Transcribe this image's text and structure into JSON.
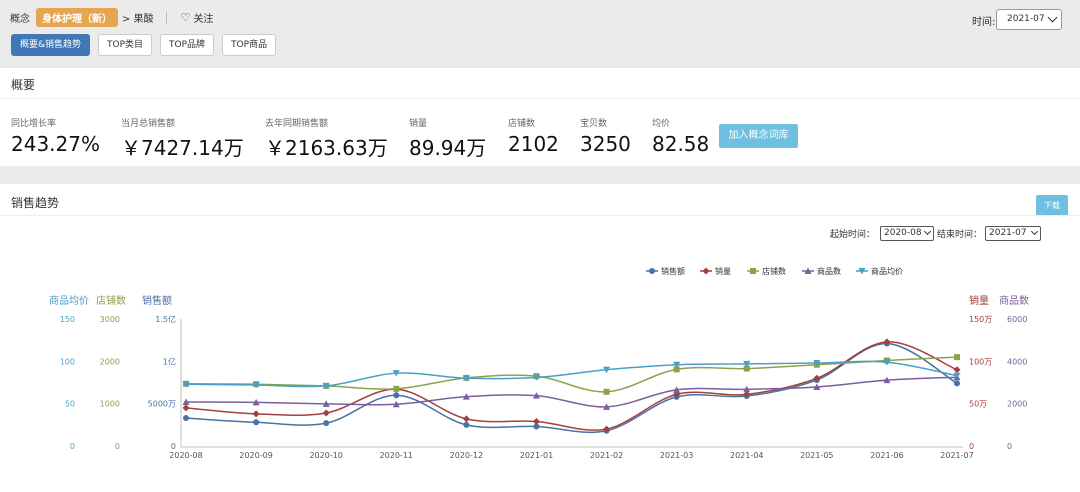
{
  "breadcrumb": {
    "prefix": "概念",
    "tag": "身体护理（新）",
    "tail": "> 果酸",
    "follow_icon": "heart-outline-icon",
    "follow_label": "关注"
  },
  "tabs": [
    {
      "label": "概要&销售趋势",
      "active": true
    },
    {
      "label": "TOP类目",
      "active": false
    },
    {
      "label": "TOP品牌",
      "active": false
    },
    {
      "label": "TOP商品",
      "active": false
    }
  ],
  "time_filter": {
    "label": "时间:",
    "value": "2021-07"
  },
  "overview": {
    "title": "概要",
    "stats": [
      {
        "label": "同比增长率",
        "value": "243.27%"
      },
      {
        "label": "当月总销售额",
        "value": "￥7427.14万"
      },
      {
        "label": "去年同期销售额",
        "value": "￥2163.63万"
      },
      {
        "label": "销量",
        "value": "89.94万"
      },
      {
        "label": "店铺数",
        "value": "2102"
      },
      {
        "label": "宝贝数",
        "value": "3250"
      },
      {
        "label": "均价",
        "value": "82.58"
      }
    ],
    "add_button": "加入概念词库"
  },
  "trend": {
    "title": "销售趋势",
    "download": "下载",
    "start_label": "起始时间：",
    "start_value": "2020-08",
    "end_label": "结束时间：",
    "end_value": "2021-07"
  },
  "chart_data": {
    "type": "line",
    "categories": [
      "2020-08",
      "2020-09",
      "2020-10",
      "2020-11",
      "2020-12",
      "2021-01",
      "2021-02",
      "2021-03",
      "2021-04",
      "2021-05",
      "2021-06",
      "2021-07"
    ],
    "legend_position": "top-right",
    "grid": false,
    "axes": {
      "left": [
        {
          "name": "商品均价",
          "ticks": [
            "0",
            "50",
            "100",
            "150"
          ],
          "range": [
            0,
            150
          ],
          "color": "#4a9fc9"
        },
        {
          "name": "店铺数",
          "ticks": [
            "0",
            "1000",
            "2000",
            "3000"
          ],
          "range": [
            0,
            3000
          ],
          "color": "#8aa34a"
        },
        {
          "name": "销售额",
          "ticks": [
            "0",
            "5000万",
            "1亿",
            "1.5亿"
          ],
          "range": [
            0,
            15000
          ],
          "color": "#4572a7"
        }
      ],
      "right": [
        {
          "name": "销量",
          "ticks": [
            "0",
            "50万",
            "100万",
            "150万"
          ],
          "range": [
            0,
            150
          ],
          "color": "#a3403d"
        },
        {
          "name": "商品数",
          "ticks": [
            "0",
            "2000",
            "4000",
            "6000"
          ],
          "range": [
            0,
            6000
          ],
          "color": "#7a5f9c"
        }
      ]
    },
    "series": [
      {
        "name": "销售额",
        "axis": "left.2",
        "color": "#4572a7",
        "marker": "circle",
        "values": [
          3300,
          2800,
          2700,
          6000,
          2500,
          2300,
          1800,
          5800,
          5900,
          7800,
          12100,
          7400
        ]
      },
      {
        "name": "销量",
        "axis": "right.0",
        "color": "#a3403d",
        "marker": "diamond",
        "values": [
          45,
          38,
          39,
          67,
          32,
          29,
          20,
          61,
          61,
          80,
          123,
          90
        ]
      },
      {
        "name": "店铺数",
        "axis": "left.1",
        "color": "#8aa34a",
        "marker": "square",
        "values": [
          1470,
          1460,
          1420,
          1350,
          1610,
          1650,
          1280,
          1810,
          1830,
          1920,
          2020,
          2100
        ]
      },
      {
        "name": "商品数",
        "axis": "right.1",
        "color": "#7a5f9c",
        "marker": "triangle",
        "values": [
          2080,
          2060,
          1990,
          1970,
          2330,
          2380,
          1850,
          2650,
          2680,
          2790,
          3110,
          3250
        ]
      },
      {
        "name": "商品均价",
        "axis": "left.0",
        "color": "#4a9fc9",
        "marker": "triangle-down",
        "values": [
          73,
          72,
          71,
          86,
          80,
          81,
          90,
          96,
          97,
          98,
          99,
          83
        ]
      }
    ]
  }
}
